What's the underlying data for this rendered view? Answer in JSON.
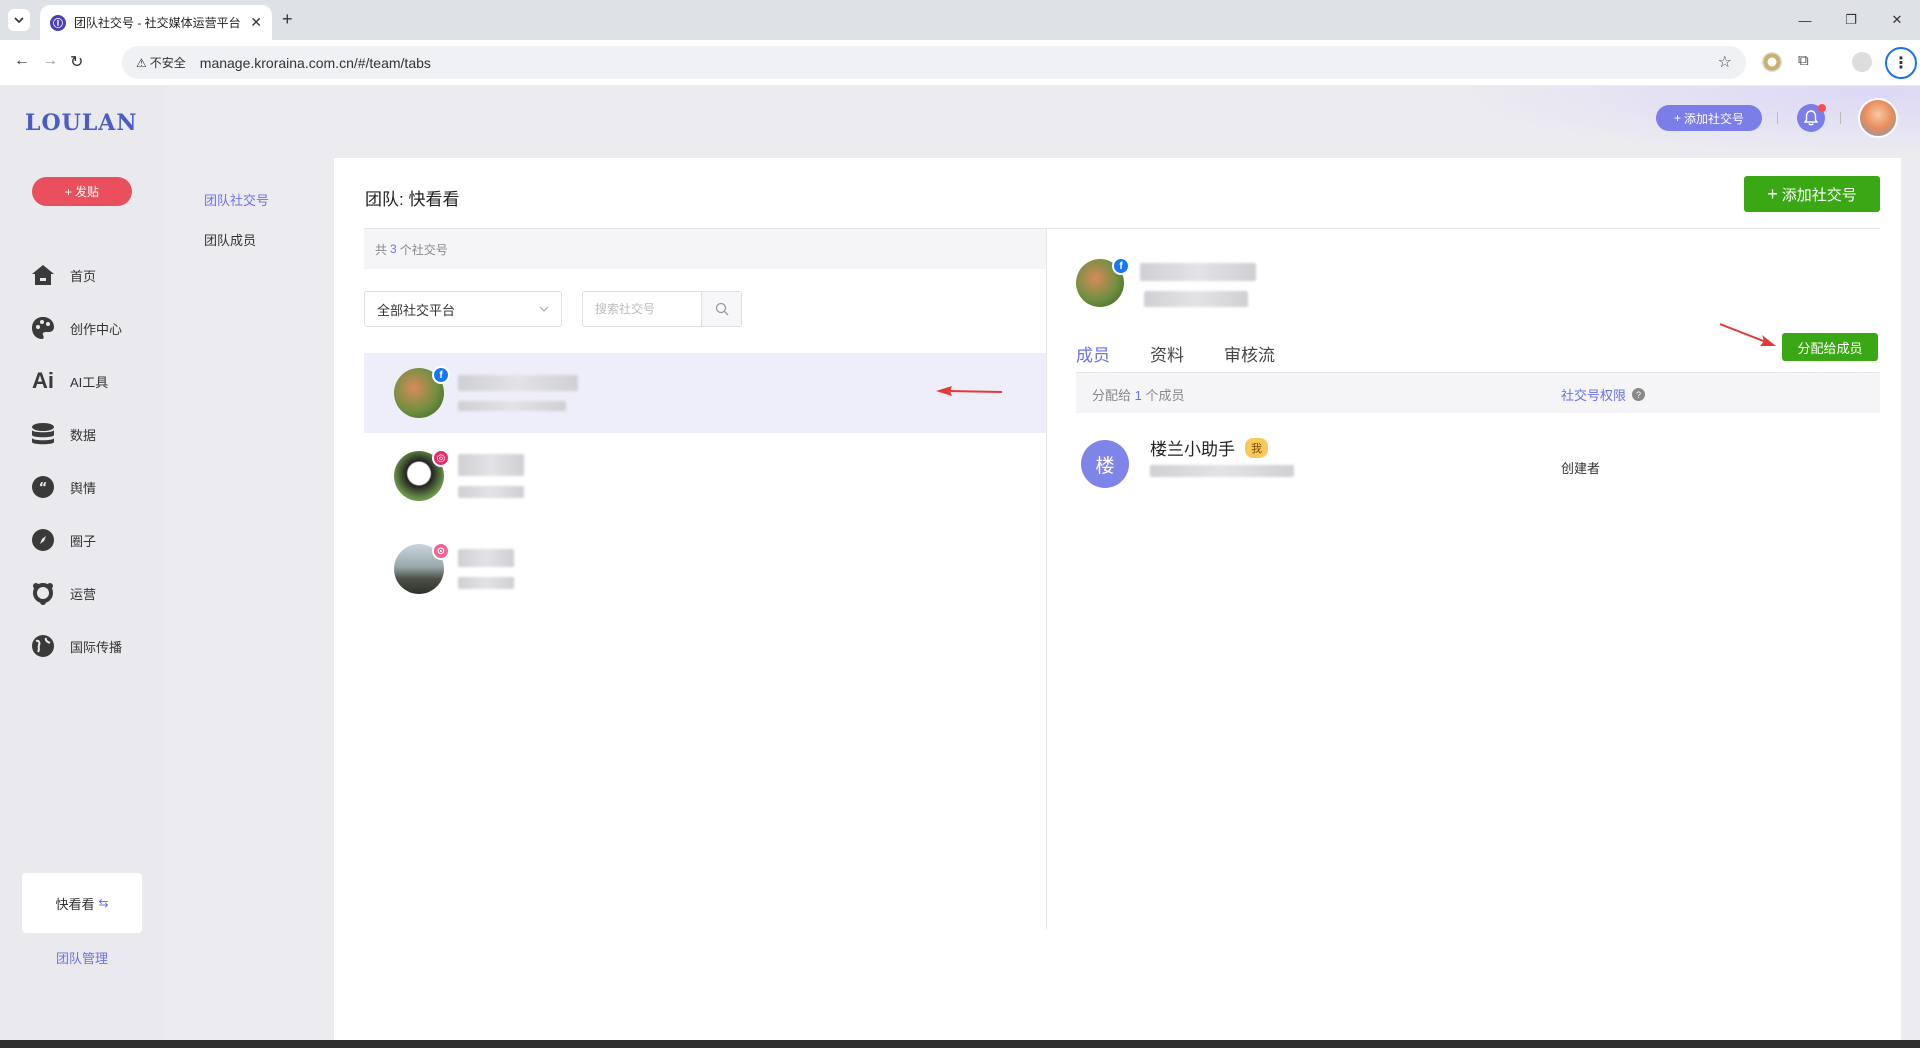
{
  "browser": {
    "tab_title": "团队社交号 - 社交媒体运营平台",
    "url": "manage.kroraina.com.cn/#/team/tabs",
    "security_label": "不安全"
  },
  "sidebar": {
    "logo": "LOULAN",
    "post_button": "发贴",
    "items": [
      {
        "label": "首页",
        "icon": "home-icon"
      },
      {
        "label": "创作中心",
        "icon": "palette-icon"
      },
      {
        "label": "AI工具",
        "icon": "ai-icon"
      },
      {
        "label": "数据",
        "icon": "database-icon"
      },
      {
        "label": "舆情",
        "icon": "quote-icon"
      },
      {
        "label": "圈子",
        "icon": "compass-icon"
      },
      {
        "label": "运营",
        "icon": "operations-icon"
      },
      {
        "label": "国际传播",
        "icon": "globe-icon"
      }
    ],
    "team_name": "快看看",
    "team_management": "团队管理"
  },
  "header": {
    "add_account": "添加社交号"
  },
  "subnav": {
    "items": [
      "团队社交号",
      "团队成员"
    ],
    "active": "团队社交号"
  },
  "main": {
    "title": "团队: 快看看",
    "add_account_button": "添加社交号",
    "count_prefix": "共",
    "count": "3",
    "count_suffix": "个社交号",
    "platform_filter": "全部社交平台",
    "search_placeholder": "搜索社交号",
    "accounts": [
      {
        "platform": "facebook",
        "badge_color": "#1877f2"
      },
      {
        "platform": "instagram",
        "badge_color": "#e1306c"
      },
      {
        "platform": "other",
        "badge_color": "#f06595"
      }
    ]
  },
  "detail": {
    "tabs": [
      "成员",
      "资料",
      "审核流"
    ],
    "active_tab": "成员",
    "assign_button": "分配给成员",
    "assigned_prefix": "分配给",
    "assigned_count": "1",
    "assigned_suffix": "个成员",
    "permission_header": "社交号权限",
    "members": [
      {
        "avatar_char": "楼",
        "name": "楼兰小助手",
        "badge": "我",
        "role": "创建者"
      }
    ]
  },
  "colors": {
    "accent": "#6b72e6",
    "green": "#3aa814",
    "post_red": "#ea4f5d"
  }
}
